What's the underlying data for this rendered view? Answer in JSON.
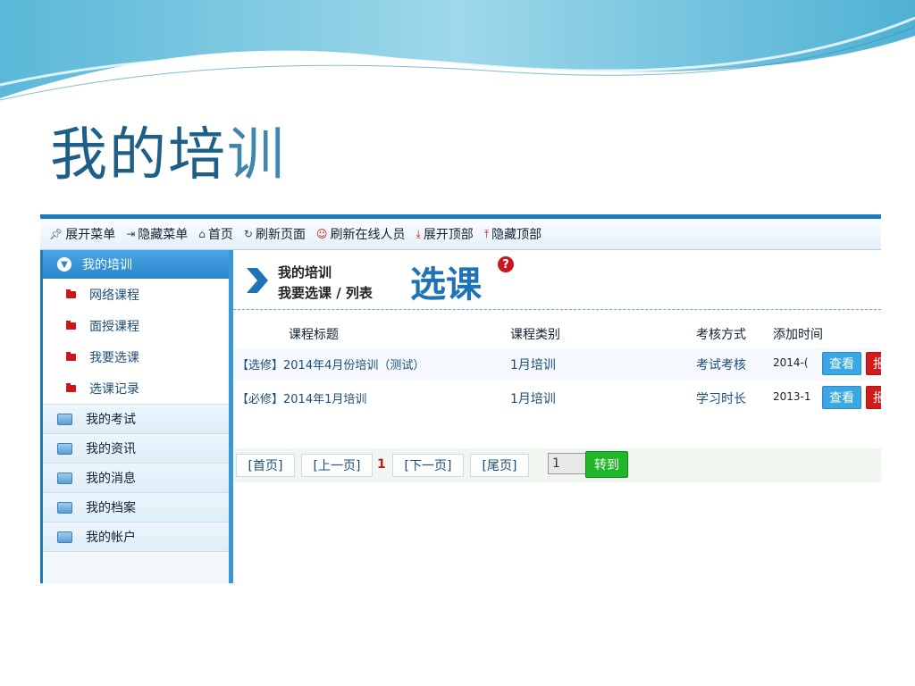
{
  "slide": {
    "title_dark": "我的培",
    "title_light": "训"
  },
  "toolbar": {
    "items": [
      {
        "label": "展开菜单",
        "icon": "pin-icon"
      },
      {
        "label": "隐藏菜单",
        "icon": "unpin-icon"
      },
      {
        "label": "首页",
        "icon": "home-icon"
      },
      {
        "label": "刷新页面",
        "icon": "refresh-icon"
      },
      {
        "label": "刷新在线人员",
        "icon": "user-icon"
      },
      {
        "label": "展开顶部",
        "icon": "arrow-down-icon"
      },
      {
        "label": "隐藏顶部",
        "icon": "arrow-up-icon"
      }
    ]
  },
  "sidebar": {
    "header": "我的培训",
    "subitems": [
      "网络课程",
      "面授课程",
      "我要选课",
      "选课记录"
    ],
    "items": [
      "我的考试",
      "我的资讯",
      "我的消息",
      "我的档案",
      "我的帐户"
    ]
  },
  "breadcrumb": {
    "line1": "我的培训",
    "line2": "我要选课 / 列表",
    "title": "选课",
    "help": "?"
  },
  "table": {
    "headers": [
      "课程标题",
      "课程类别",
      "考核方式",
      "添加时间"
    ],
    "rows": [
      {
        "title": "【选修】2014年4月份培训（测试）",
        "category": "1月培训",
        "method": "考试考核",
        "time": "2014-(",
        "view": "查看",
        "join": "报名"
      },
      {
        "title": "【必修】2014年1月培训",
        "category": "1月培训",
        "method": "学习时长",
        "time": "2013-1",
        "view": "查看",
        "join": "报名"
      }
    ]
  },
  "pager": {
    "first": "[首页]",
    "prev": "[上一页]",
    "current": "1",
    "next": "[下一页]",
    "last": "[尾页]",
    "input_value": "1",
    "go": "转到"
  },
  "colors": {
    "accent": "#1a7bbf",
    "title": "#1d5f86",
    "danger": "#d21c1c",
    "go": "#1fb82a"
  }
}
